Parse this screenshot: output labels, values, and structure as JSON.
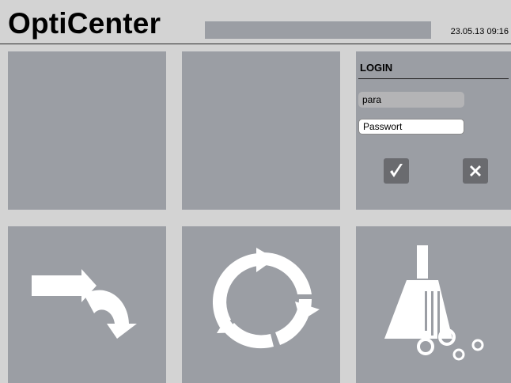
{
  "header": {
    "title": "OptiCenter",
    "datetime": "23.05.13 09:16"
  },
  "login": {
    "title": "LOGIN",
    "username_value": "para",
    "password_placeholder": "Passwort",
    "confirm_icon": "check-icon",
    "cancel_icon": "close-icon"
  },
  "tiles": {
    "bottom_left_icon": "forward-arrow-icon",
    "bottom_center_icon": "refresh-cycle-icon",
    "bottom_right_icon": "broom-clean-icon"
  },
  "colors": {
    "background": "#d3d3d3",
    "tile": "#9b9ea4",
    "button": "#6a6b6f",
    "icon": "#ffffff"
  }
}
